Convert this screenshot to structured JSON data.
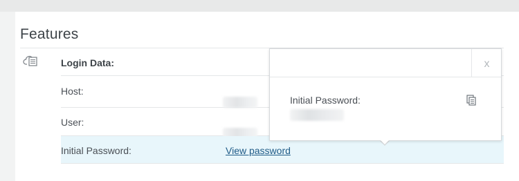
{
  "section": {
    "title": "Features"
  },
  "rows": {
    "login_label": "Login Data:",
    "host_label": "Host:",
    "user_label": "User:",
    "password_label": "Initial Password:",
    "password_link": "View password"
  },
  "popover": {
    "close_label": "x",
    "password_label": "Initial Password:"
  },
  "icons": {
    "section_icon": "cloud-server-icon",
    "copy_icon": "copy-icon"
  },
  "colors": {
    "link": "#1f5b87",
    "highlight_row": "#e8f6fb"
  }
}
